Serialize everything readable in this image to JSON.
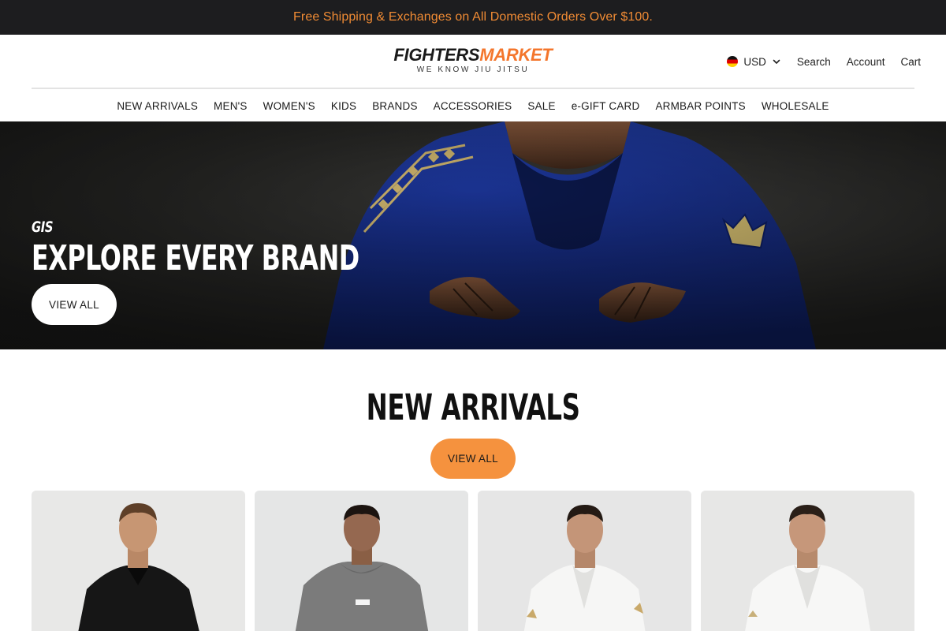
{
  "announcement": {
    "text": "Free Shipping & Exchanges on All Domestic Orders Over $100."
  },
  "header": {
    "logo_part1": "FIGHTERS",
    "logo_part2": "MARKET",
    "tagline": "WE KNOW JIU JITSU",
    "currency": "USD",
    "currency_flag": "germany-flag-icon",
    "search_label": "Search",
    "account_label": "Account",
    "cart_label": "Cart"
  },
  "nav": {
    "items": [
      "NEW ARRIVALS",
      "MEN'S",
      "WOMEN'S",
      "KIDS",
      "BRANDS",
      "ACCESSORIES",
      "SALE",
      "e-GIFT CARD",
      "ARMBAR POINTS",
      "WHOLESALE"
    ]
  },
  "hero": {
    "eyebrow": "GIS",
    "title": "EXPLORE EVERY BRAND",
    "button_label": "VIEW ALL"
  },
  "new_arrivals": {
    "title": "NEW ARRIVALS",
    "button_label": "VIEW ALL",
    "products": [
      {
        "image": "man-black-jacket"
      },
      {
        "image": "man-gray-hoodie"
      },
      {
        "image": "man-white-gi"
      },
      {
        "image": "man-white-gi"
      }
    ]
  },
  "colors": {
    "announcement_bg": "#1d1d1f",
    "accent_orange": "#f4762c",
    "button_orange": "#f5923e"
  }
}
